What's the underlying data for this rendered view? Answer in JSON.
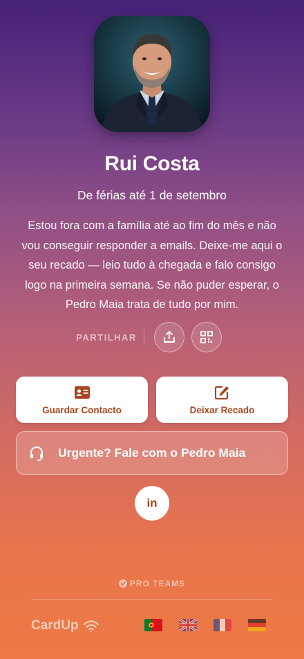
{
  "profile": {
    "name": "Rui Costa",
    "status": "De férias até 1 de setembro",
    "bio": "Estou fora com a família até ao fim do mês e não vou conseguir responder a emails. Deixe-me aqui o seu recado — leio tudo à chegada e falo consigo logo na primeira semana. Se não puder esperar, o Pedro Maia trata de tudo por mim."
  },
  "share": {
    "label": "PARTILHAR",
    "icons": [
      "share-upload-icon",
      "qr-code-icon"
    ]
  },
  "actions": {
    "save_contact": {
      "label": "Guardar Contacto",
      "icon": "contact-card-icon"
    },
    "leave_message": {
      "label": "Deixar Recado",
      "icon": "edit-icon"
    },
    "urgent": {
      "label": "Urgente? Fale com o Pedro Maia",
      "icon": "headset-icon"
    }
  },
  "social": {
    "linkedin": "in"
  },
  "footer": {
    "pro_label": "PRO TEAMS",
    "brand": "CardUp",
    "languages": [
      "pt",
      "en",
      "fr",
      "de"
    ]
  },
  "colors": {
    "accent": "#a8461f",
    "gradient_top": "#462178",
    "gradient_bottom": "#ee7a45"
  }
}
